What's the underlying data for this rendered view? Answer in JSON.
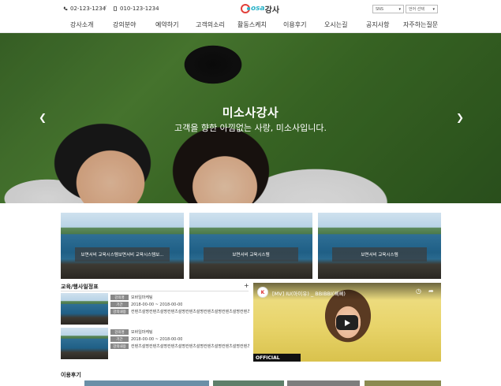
{
  "topbar": {
    "phone1": "02-123-1234",
    "separator": "/",
    "phone2": "010-123-1234",
    "logo_en": "osa",
    "logo_ko": "강사",
    "sns_select": "SNS",
    "lang_select": "언어 선택"
  },
  "nav": {
    "items": [
      "강사소개",
      "강의분야",
      "예약하기",
      "고객의소리",
      "활동스케치",
      "이용후기",
      "오시는길",
      "공지사항",
      "자주하는질문"
    ]
  },
  "hero": {
    "title": "미소사강사",
    "subtitle": "고객을 향한 아낌없는 사랑, 미소사입니다."
  },
  "cards": [
    {
      "label": "보면서비 교육시스템보면서비 교육시스템보..."
    },
    {
      "label": "보면서비 교육시스템"
    },
    {
      "label": "보면서비 교육시스템"
    }
  ],
  "schedule": {
    "title": "교육/행사일정표",
    "more": "+",
    "items": [
      {
        "tags": [
          "강의명",
          "기간",
          "강의내용"
        ],
        "name": "모바일마케팅",
        "period": "2018-00-00 ~ 2018-00-00",
        "desc": "컨텐츠설명컨텐츠설명컨텐츠설명컨텐츠설명컨텐츠설명컨텐츠설명컨텐츠..."
      },
      {
        "tags": [
          "강의명",
          "기간",
          "강의내용"
        ],
        "name": "모바일마케팅",
        "period": "2018-00-00 ~ 2018-00-00",
        "desc": "컨텐츠설명컨텐츠설명컨텐츠설명컨텐츠설명컨텐츠설명컨텐츠설명컨텐츠..."
      }
    ]
  },
  "video": {
    "channel": "K",
    "title": "[MV] IU(아이유) _ BBIBBI(삐삐)",
    "corner_text": "OFFICIAL"
  },
  "review": {
    "title": "이용후기"
  }
}
